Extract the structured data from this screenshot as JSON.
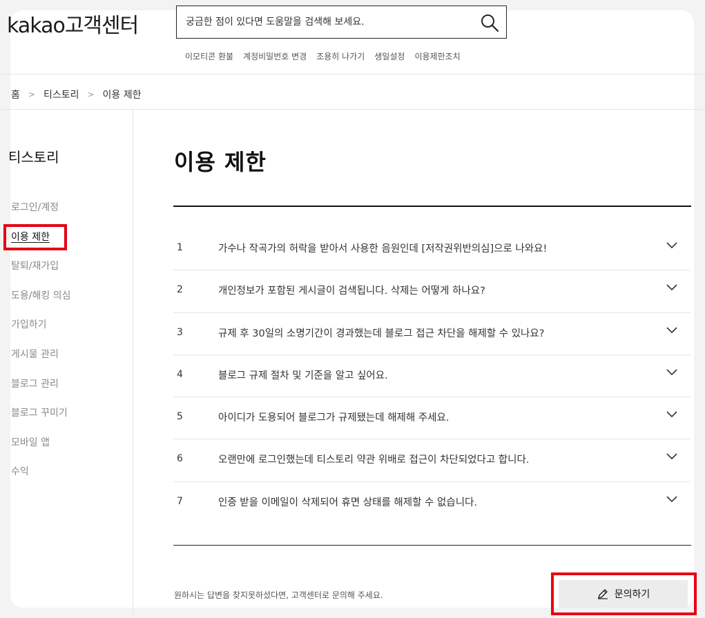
{
  "header": {
    "logo": "kakao고객센터",
    "search_placeholder": "궁금한 점이 있다면 도움말을 검색해 보세요.",
    "quick_links": [
      "이모티콘 환불",
      "계정비밀번호 변경",
      "조용히 나가기",
      "생일설정",
      "이용제한조치"
    ]
  },
  "breadcrumb": {
    "items": [
      "홈",
      "티스토리",
      "이용 제한"
    ]
  },
  "sidebar": {
    "title": "티스토리",
    "items": [
      "로그인/계정",
      "이용 제한",
      "탈퇴/재가입",
      "도용/해킹 의심",
      "가입하기",
      "게시물 관리",
      "블로그 관리",
      "블로그 꾸미기",
      "모바일 앱",
      "수익"
    ],
    "active_index": 1
  },
  "main": {
    "title": "이용 제한",
    "faq": [
      {
        "num": "1",
        "question": "가수나 작곡가의 허락을 받아서 사용한 음원인데 [저작권위반의심]으로 나와요!"
      },
      {
        "num": "2",
        "question": "개인정보가 포함된 게시글이 검색됩니다. 삭제는 어떻게 하나요?"
      },
      {
        "num": "3",
        "question": "규제 후 30일의 소명기간이 경과했는데 블로그 접근 차단을 해제할 수 있나요?"
      },
      {
        "num": "4",
        "question": "블로그 규제 절차 및 기준을 알고 싶어요."
      },
      {
        "num": "5",
        "question": "아이디가 도용되어 블로그가 규제됐는데 해제해 주세요."
      },
      {
        "num": "6",
        "question": "오랜만에 로그인했는데 티스토리 약관 위배로 접근이 차단되었다고 합니다."
      },
      {
        "num": "7",
        "question": "인증 받을 이메일이 삭제되어 휴면 상태를 해제할 수 없습니다."
      }
    ],
    "footer_note": "원하시는 답변을 찾지못하셨다면, 고객센터로 문의해 주세요.",
    "inquiry_label": "문의하기"
  },
  "highlight_color": "#e60012"
}
